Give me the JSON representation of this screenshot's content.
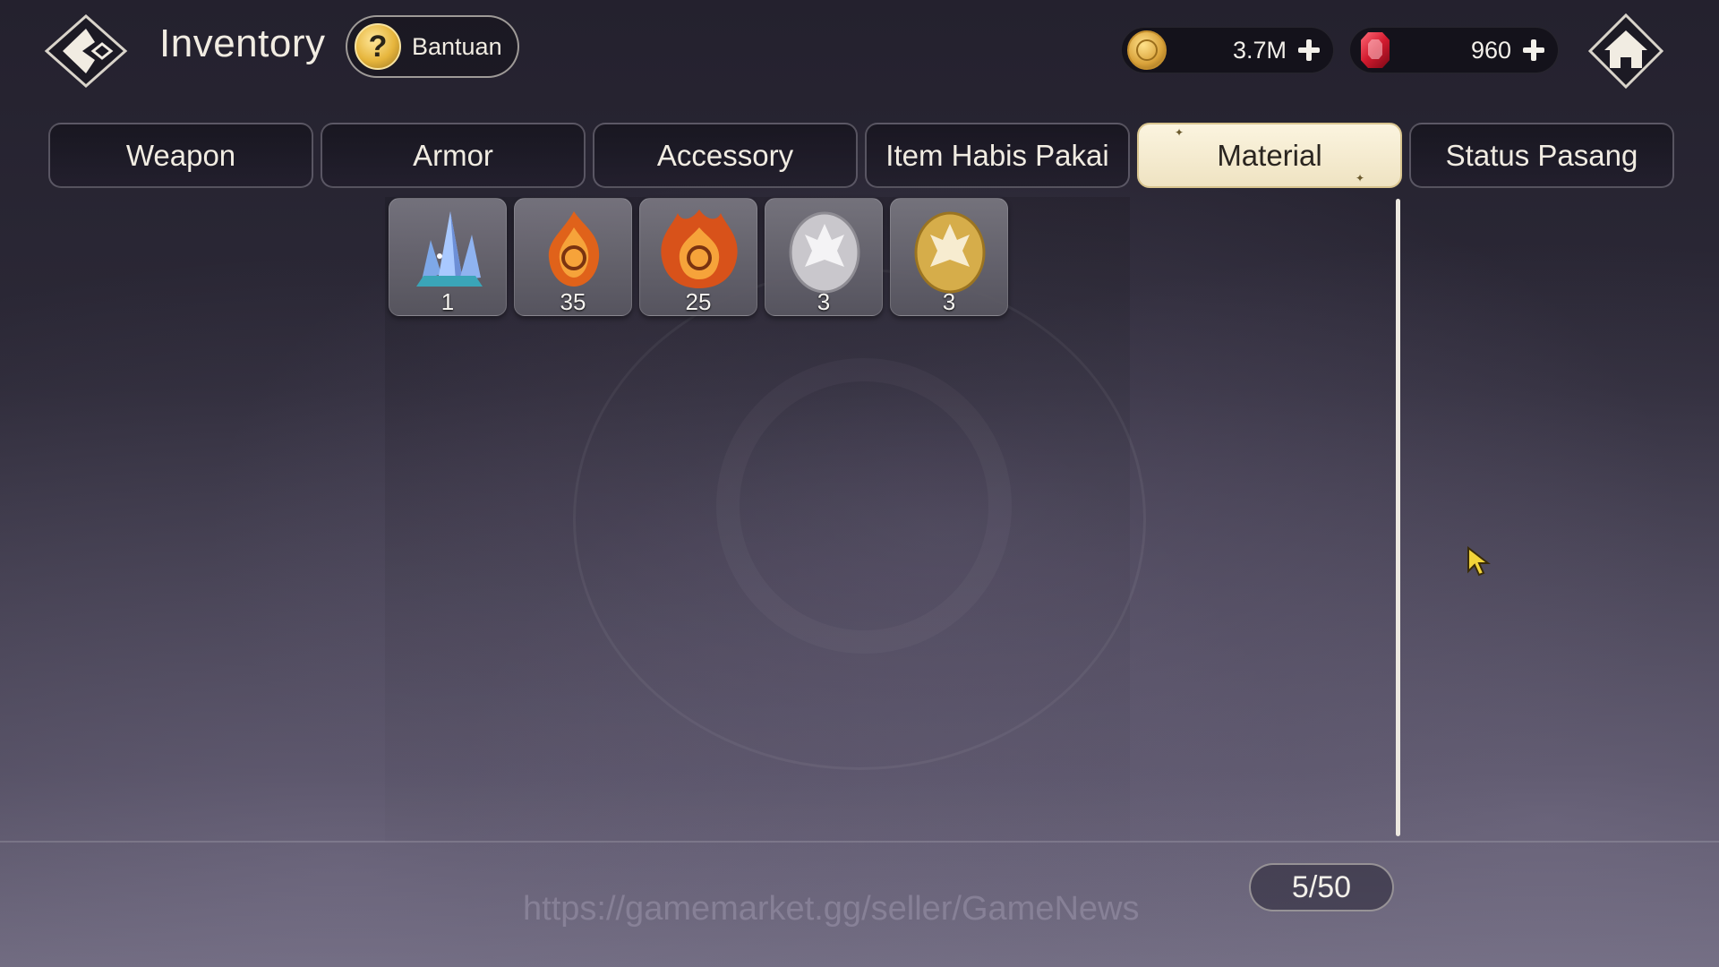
{
  "header": {
    "title": "Inventory",
    "help_label": "Bantuan"
  },
  "currencies": {
    "gold": {
      "value": "3.7M",
      "icon": "gold-coin-icon",
      "color": "#d9a23a"
    },
    "gem": {
      "value": "960",
      "icon": "red-gem-icon",
      "color": "#d21a2e"
    }
  },
  "tabs": [
    {
      "label": "Weapon",
      "active": false
    },
    {
      "label": "Armor",
      "active": false
    },
    {
      "label": "Accessory",
      "active": false
    },
    {
      "label": "Item Habis Pakai",
      "active": false
    },
    {
      "label": "Material",
      "active": true
    },
    {
      "label": "Status Pasang",
      "active": false
    }
  ],
  "items": [
    {
      "icon": "blue-crystal-icon",
      "count": "1"
    },
    {
      "icon": "fire-orb-icon",
      "count": "35"
    },
    {
      "icon": "large-fire-orb-icon",
      "count": "25"
    },
    {
      "icon": "silver-egg-icon",
      "count": "3"
    },
    {
      "icon": "gold-egg-icon",
      "count": "3"
    }
  ],
  "footer": {
    "capacity": "5/50",
    "watermark": "https://gamemarket.gg/seller/GameNews"
  },
  "colors": {
    "active_tab": "#efe3c2",
    "background": "#2c2937"
  }
}
